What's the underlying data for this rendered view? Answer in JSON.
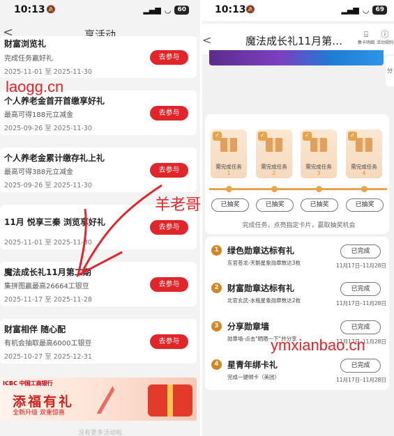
{
  "left": {
    "status": {
      "time": "10:13",
      "silent": "🔕",
      "signal": "▂▄▆",
      "wifi": "◡",
      "battery": "60"
    },
    "nav": {
      "back": "<",
      "title": "享活动"
    },
    "cards": [
      {
        "title": "财富浏览礼",
        "subtitle": "完成任务赢好礼",
        "date": "2025-11-01 至 2025-11-30",
        "button": "去参与"
      },
      {
        "title": "个人养老金首开首缴享好礼",
        "subtitle": "最高可得188元立减金",
        "date": "2025-09-26 至 2025-11-30",
        "button": "去参与"
      },
      {
        "title": "个人养老金累计缴存礼上礼",
        "subtitle": "最高可得388元立减金",
        "date": "2025-09-26 至 2025-11-30",
        "button": "去参与"
      },
      {
        "title": "11月 悦享三秦 浏览享好礼",
        "subtitle": "",
        "date": "2025-11-01 至 2025-11-30",
        "button": "去参与"
      },
      {
        "title": "魔法成长礼11月第二期",
        "subtitle": "集拼图赢最高26664工银豆",
        "date": "2025-11-17 至 2025-11-28",
        "button": "去参与"
      },
      {
        "title": "财富相伴 随心配",
        "subtitle": "有机会抽取最高6000工银豆",
        "date": "2025-10-27 至 2025-12-31",
        "button": "去参与"
      }
    ],
    "banner": {
      "logo": "ICBC 中国工商银行",
      "headline": "添福有礼",
      "tagline": "全新升级  双重惊喜"
    },
    "footer": "没有更多活动啦"
  },
  "watermarks": {
    "left": "laogg.cn",
    "middle": "羊老哥",
    "right": "ymxianbao.cn"
  },
  "right": {
    "status": {
      "time": "10:13",
      "silent": "🔕",
      "signal": "▂▄▆",
      "wifi": "◡",
      "battery": "69"
    },
    "nav": {
      "back": "<",
      "title": "魔法成长礼11月第…",
      "tool1": "集卡明细",
      "tool2": "活动规则",
      "side": "分"
    },
    "boxes": [
      {
        "label": "需完成任务",
        "num": "1"
      },
      {
        "label": "需完成任务",
        "num": "2"
      },
      {
        "label": "需完成任务",
        "num": "3"
      },
      {
        "label": "需完成任务",
        "num": "4"
      }
    ],
    "draw_buttons": [
      "已抽奖",
      "已抽奖",
      "已抽奖",
      "已抽奖"
    ],
    "hint": "完成任务，点亮指定卡片，赢取抽奖机会",
    "tasks": [
      {
        "num": "1",
        "name": "绿色勋章达标有礼",
        "desc": "东官苍龙-天鹅星象勋章数达3枚",
        "button": "已完成",
        "date": "11月17日–11月28日"
      },
      {
        "num": "2",
        "name": "财富勋章达标有礼",
        "desc": "北官玄武-水瓶星象勋章数达2枚",
        "button": "已完成",
        "date": "11月17日–11月28日"
      },
      {
        "num": "3",
        "name": "分享勋章墙",
        "desc": "勋章墙-点击\"晒晒一下\"并分享",
        "button": "已完成",
        "date": "11月17日–11月28日"
      },
      {
        "num": "4",
        "name": "星青年绑卡礼",
        "desc": "完成一键绑卡（美团）",
        "button": "已完成",
        "date": "11月17日–11月28日"
      }
    ]
  }
}
